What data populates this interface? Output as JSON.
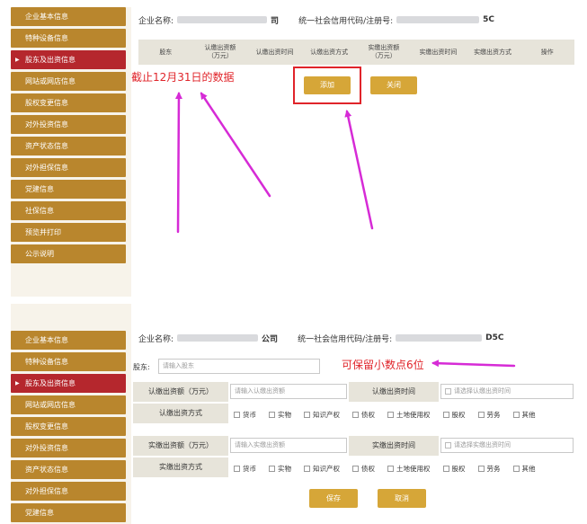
{
  "sidebar_top": [
    {
      "label": "企业基本信息",
      "active": false
    },
    {
      "label": "特种设备信息",
      "active": false
    },
    {
      "label": "股东及出资信息",
      "active": true
    },
    {
      "label": "网站或网店信息",
      "active": false
    },
    {
      "label": "股权变更信息",
      "active": false
    },
    {
      "label": "对外投资信息",
      "active": false
    },
    {
      "label": "资产状态信息",
      "active": false
    },
    {
      "label": "对外担保信息",
      "active": false
    },
    {
      "label": "党建信息",
      "active": false
    },
    {
      "label": "社保信息",
      "active": false
    },
    {
      "label": "预览并打印",
      "active": false
    },
    {
      "label": "公示说明",
      "active": false
    }
  ],
  "sidebar_bottom": [
    {
      "label": "企业基本信息",
      "active": false
    },
    {
      "label": "特种设备信息",
      "active": false
    },
    {
      "label": "股东及出资信息",
      "active": true
    },
    {
      "label": "网站或网店信息",
      "active": false
    },
    {
      "label": "股权变更信息",
      "active": false
    },
    {
      "label": "对外投资信息",
      "active": false
    },
    {
      "label": "资产状态信息",
      "active": false
    },
    {
      "label": "对外担保信息",
      "active": false
    },
    {
      "label": "党建信息",
      "active": false
    }
  ],
  "header_top": {
    "company_label": "企业名称:",
    "company_suffix": "司",
    "credit_label": "统一社会信用代码/注册号:",
    "credit_suffix": "5C"
  },
  "header_bottom": {
    "company_label": "企业名称:",
    "company_suffix": "公司",
    "credit_label": "统一社会信用代码/注册号:",
    "credit_suffix": "D5C"
  },
  "table": {
    "headers": [
      "股东",
      "认缴出资额\n（万元）",
      "认缴出资时间",
      "认缴出资方式",
      "实缴出资额\n（万元）",
      "实缴出资时间",
      "实缴出资方式",
      "操作"
    ]
  },
  "buttons": {
    "add": "添加",
    "close": "关闭",
    "save": "保存",
    "cancel": "取消"
  },
  "annotations": {
    "top": "截止12月31日的数据",
    "bottom": "可保留小数点6位"
  },
  "form": {
    "shareholder_label": "股东:",
    "shareholder_placeholder": "请输入股东",
    "subscribed_amount_label": "认缴出资额（万元）",
    "subscribed_amount_placeholder": "请输入认缴出资额",
    "subscribed_time_label": "认缴出资时间",
    "subscribed_time_placeholder": "请选择认缴出资时间",
    "subscribed_method_label": "认缴出资方式",
    "paid_amount_label": "实缴出资额（万元）",
    "paid_amount_placeholder": "请输入实缴出资额",
    "paid_time_label": "实缴出资时间",
    "paid_time_placeholder": "请选择实缴出资时间",
    "paid_method_label": "实缴出资方式",
    "methods": [
      "货币",
      "实物",
      "知识产权",
      "债权",
      "土地使用权",
      "股权",
      "劳务",
      "其他"
    ]
  },
  "colors": {
    "sidebar": "#b9862d",
    "sidebar_active": "#b5272d",
    "button": "#d6a638",
    "annotation": "#e0242a",
    "arrow": "#d62bd6"
  }
}
